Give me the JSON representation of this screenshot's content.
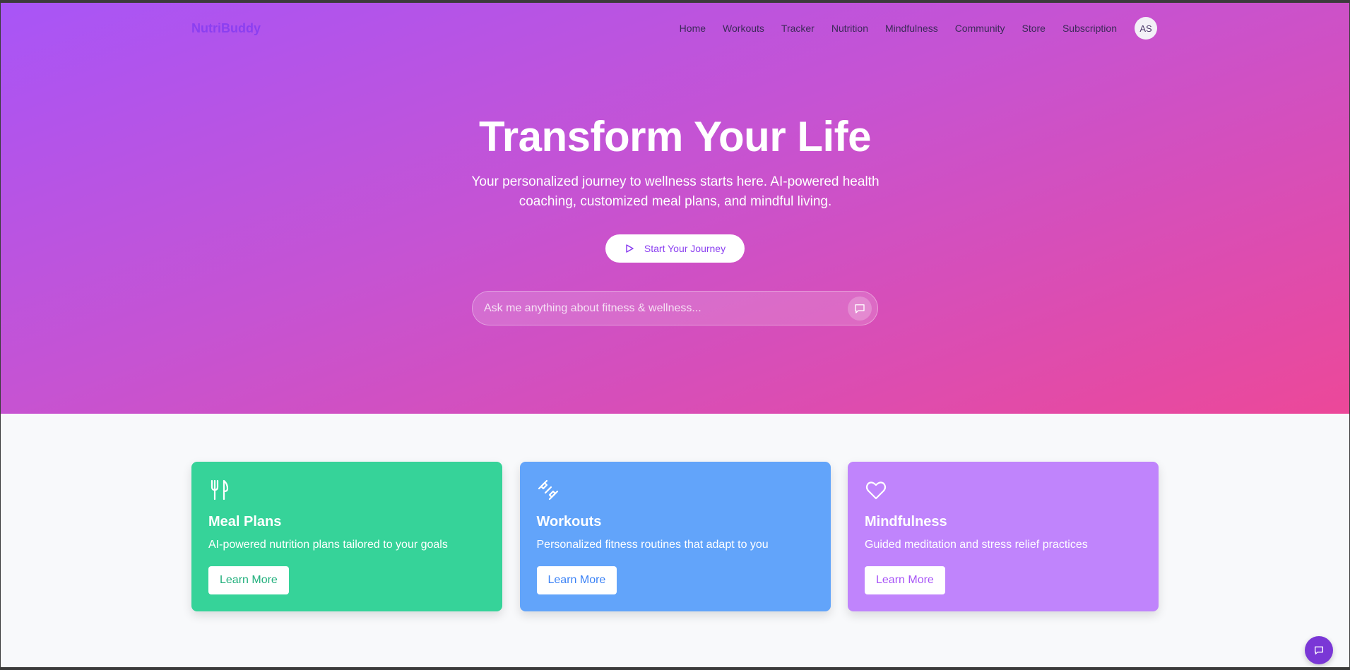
{
  "brand": "NutriBuddy",
  "nav": {
    "links": [
      "Home",
      "Workouts",
      "Tracker",
      "Nutrition",
      "Mindfulness",
      "Community",
      "Store",
      "Subscription"
    ],
    "avatar_initials": "AS"
  },
  "hero": {
    "title": "Transform Your Life",
    "subtitle": "Your personalized journey to wellness starts here. AI-powered health coaching, customized meal plans, and mindful living.",
    "cta_label": "Start Your Journey",
    "search_placeholder": "Ask me anything about fitness & wellness..."
  },
  "cards": [
    {
      "title": "Meal Plans",
      "description": "AI-powered nutrition plans tailored to your goals",
      "button": "Learn More",
      "icon": "utensils-icon",
      "color": "#36d399",
      "accent": "#22b07d"
    },
    {
      "title": "Workouts",
      "description": "Personalized fitness routines that adapt to you",
      "button": "Learn More",
      "icon": "dumbbell-icon",
      "color": "#62a4fa",
      "accent": "#3b82f6"
    },
    {
      "title": "Mindfulness",
      "description": "Guided meditation and stress relief practices",
      "button": "Learn More",
      "icon": "heart-icon",
      "color": "#c084fc",
      "accent": "#a855f7"
    }
  ],
  "colors": {
    "hero_gradient_start": "#a855f7",
    "hero_gradient_end": "#ec4899",
    "brand": "#8b3ff0",
    "chat_button": "#7a37d6"
  }
}
